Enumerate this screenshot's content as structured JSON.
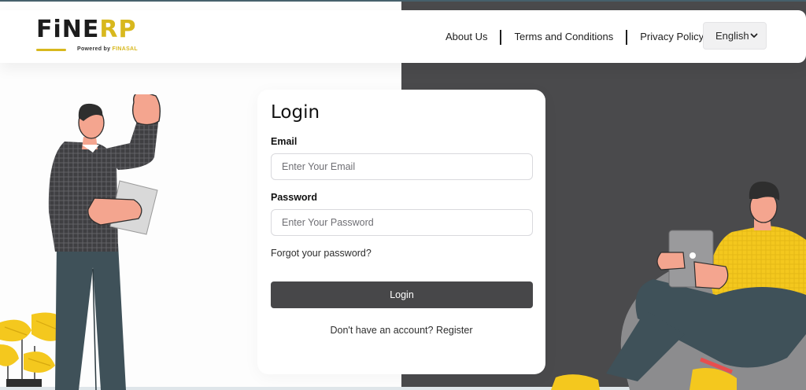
{
  "brand": {
    "logo_main": "FiNE",
    "logo_accent": "RP",
    "powered_prefix": "Powered by",
    "powered_brand": "FINASAL"
  },
  "nav": {
    "links": [
      "About Us",
      "Terms and Conditions",
      "Privacy Policy"
    ],
    "language": "English"
  },
  "login": {
    "title": "Login",
    "email_label": "Email",
    "email_placeholder": "Enter Your Email",
    "email_value": "",
    "password_label": "Password",
    "password_placeholder": "Enter Your Password",
    "password_value": "",
    "forgot": "Forgot your password?",
    "button": "Login",
    "register_prefix": "Don't have an account?",
    "register_link": "Register"
  },
  "colors": {
    "brand_yellow": "#d8b81e",
    "dark_panel": "#4a4a4c",
    "button_bg": "#474749"
  },
  "icons": {
    "language_chevron": "chevron-down-icon"
  }
}
